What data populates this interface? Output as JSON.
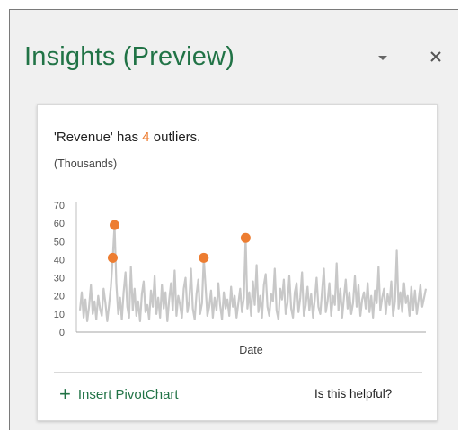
{
  "pane": {
    "title": "Insights (Preview)",
    "menu_icon": "dropdown-triangle-icon",
    "close_icon": "close-icon",
    "accent_color": "#217346"
  },
  "card": {
    "headline_before": "'Revenue' has ",
    "headline_count": "4",
    "headline_after": " outliers.",
    "units": "(Thousands)",
    "actions": {
      "insert_label": "Insert PivotChart",
      "insert_icon": "plus-icon",
      "helpful_label": "Is this helpful?"
    }
  },
  "chart_data": {
    "type": "line",
    "title": "",
    "xlabel": "Date",
    "ylabel": "",
    "ylim": [
      0,
      70
    ],
    "yticks": [
      0,
      10,
      20,
      30,
      40,
      50,
      60,
      70
    ],
    "grid": false,
    "legend": "none",
    "colors": {
      "line": "#c8c8c8",
      "outlier": "#ed7d31",
      "axis": "#bfbfbf"
    },
    "series": [
      {
        "values": [
          12,
          22,
          8,
          18,
          6,
          14,
          26,
          10,
          17,
          7,
          20,
          13,
          9,
          24,
          16,
          6,
          15,
          25,
          41,
          59,
          27,
          10,
          19,
          7,
          22,
          33,
          14,
          8,
          36,
          12,
          24,
          9,
          17,
          6,
          21,
          28,
          11,
          15,
          7,
          23,
          14,
          31,
          10,
          19,
          8,
          26,
          13,
          22,
          6,
          18,
          27,
          12,
          34,
          9,
          20,
          15,
          8,
          24,
          30,
          11,
          17,
          35,
          13,
          7,
          21,
          29,
          10,
          16,
          41,
          25,
          9,
          14,
          23,
          8,
          19,
          12,
          27,
          15,
          7,
          22,
          13,
          18,
          9,
          25,
          14,
          20,
          8,
          16,
          24,
          11,
          19,
          52,
          13,
          22,
          9,
          28,
          15,
          37,
          11,
          20,
          8,
          26,
          32,
          14,
          9,
          21,
          17,
          35,
          12,
          7,
          24,
          18,
          29,
          10,
          16,
          31,
          13,
          8,
          22,
          27,
          11,
          19,
          33,
          9,
          15,
          25,
          12,
          21,
          8,
          18,
          30,
          14,
          10,
          23,
          35,
          11,
          17,
          27,
          9,
          20,
          15,
          38,
          12,
          24,
          8,
          19,
          29,
          13,
          22,
          10,
          16,
          31,
          14,
          26,
          9,
          18,
          22,
          13,
          27,
          11,
          20,
          8,
          23,
          16,
          36,
          12,
          19,
          24,
          10,
          21,
          15,
          28,
          9,
          17,
          45,
          13,
          22,
          11,
          27,
          16,
          20,
          9,
          25,
          12,
          23,
          10,
          18,
          26,
          14,
          19,
          24
        ]
      }
    ],
    "outliers": [
      {
        "index": 18,
        "value": 41
      },
      {
        "index": 19,
        "value": 59
      },
      {
        "index": 68,
        "value": 41
      },
      {
        "index": 91,
        "value": 52
      }
    ]
  }
}
